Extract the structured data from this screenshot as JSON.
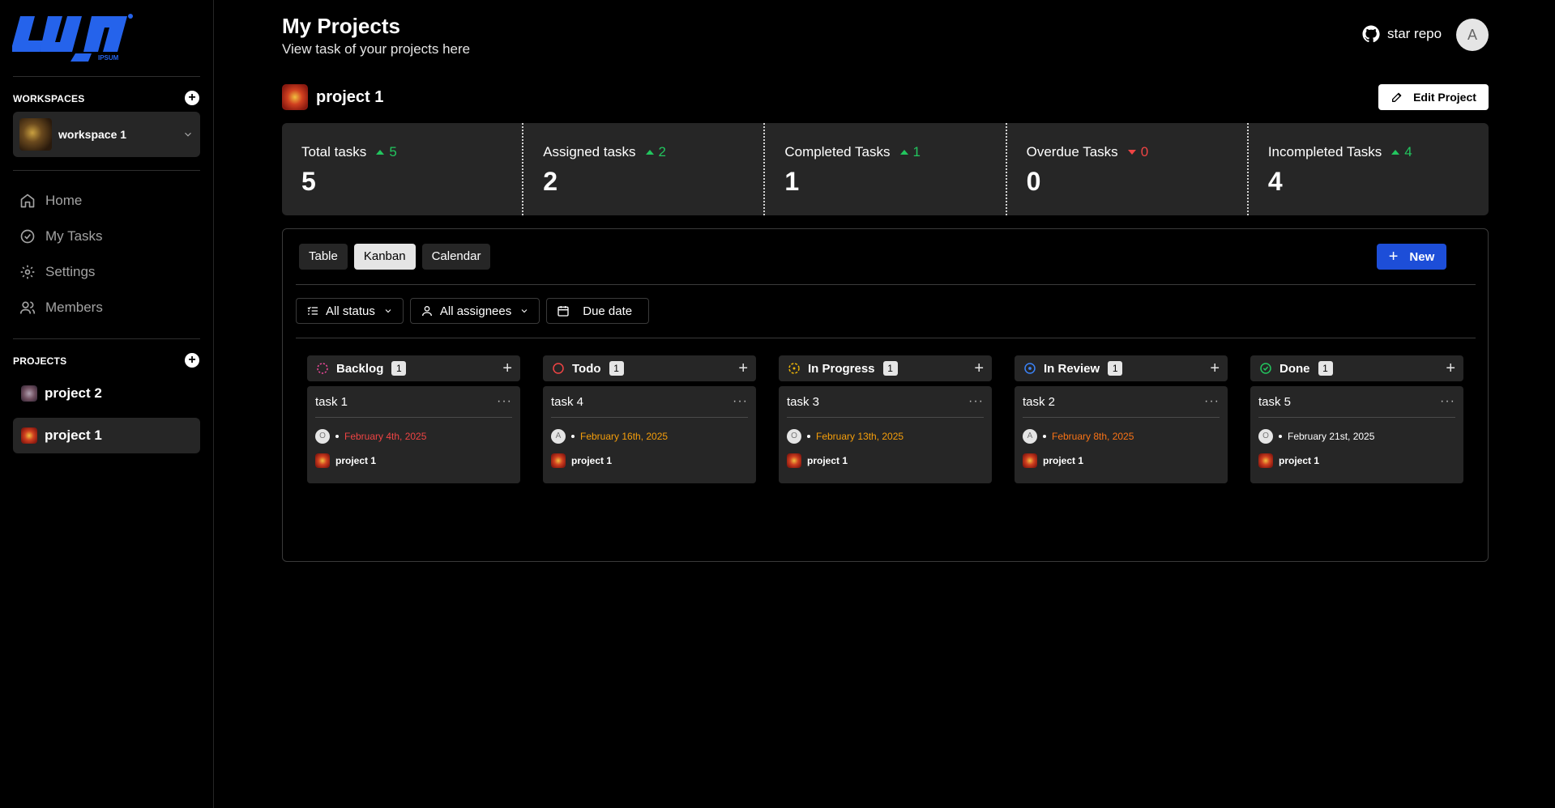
{
  "logo": {
    "subtext": "IPSUM"
  },
  "sidebar": {
    "workspaces_heading": "WORKSPACES",
    "workspace_name": "workspace 1",
    "nav": [
      {
        "label": "Home",
        "icon": "home-icon"
      },
      {
        "label": "My Tasks",
        "icon": "check-circle-icon"
      },
      {
        "label": "Settings",
        "icon": "gear-icon"
      },
      {
        "label": "Members",
        "icon": "users-icon"
      }
    ],
    "projects_heading": "PROJECTS",
    "projects": [
      {
        "name": "project 2",
        "active": false
      },
      {
        "name": "project 1",
        "active": true
      }
    ]
  },
  "header": {
    "title": "My Projects",
    "subtitle": "View task of your projects here",
    "star_repo": "star repo",
    "user_initial": "A"
  },
  "project": {
    "name": "project 1",
    "edit_label": "Edit Project"
  },
  "stats": [
    {
      "label": "Total tasks",
      "delta": "5",
      "trend": "up",
      "value": "5"
    },
    {
      "label": "Assigned tasks",
      "delta": "2",
      "trend": "up",
      "value": "2"
    },
    {
      "label": "Completed Tasks",
      "delta": "1",
      "trend": "up",
      "value": "1"
    },
    {
      "label": "Overdue Tasks",
      "delta": "0",
      "trend": "down",
      "value": "0"
    },
    {
      "label": "Incompleted Tasks",
      "delta": "4",
      "trend": "up",
      "value": "4"
    }
  ],
  "views": {
    "table": "Table",
    "kanban": "Kanban",
    "calendar": "Calendar",
    "active": "Kanban"
  },
  "new_label": "New",
  "filters": {
    "status": "All status",
    "assignees": "All assignees",
    "due": "Due date"
  },
  "columns": [
    {
      "title": "Backlog",
      "count": "1",
      "status_color": "#ec4899",
      "task": {
        "name": "task 1",
        "assignee": "O",
        "due": "February 4th, 2025",
        "due_color": "#ef4444",
        "project": "project 1"
      }
    },
    {
      "title": "Todo",
      "count": "1",
      "status_color": "#ef4444",
      "task": {
        "name": "task 4",
        "assignee": "A",
        "due": "February 16th, 2025",
        "due_color": "#f59e0b",
        "project": "project 1"
      }
    },
    {
      "title": "In Progress",
      "count": "1",
      "status_color": "#eab308",
      "task": {
        "name": "task 3",
        "assignee": "O",
        "due": "February 13th, 2025",
        "due_color": "#f59e0b",
        "project": "project 1"
      }
    },
    {
      "title": "In Review",
      "count": "1",
      "status_color": "#3b82f6",
      "task": {
        "name": "task 2",
        "assignee": "A",
        "due": "February 8th, 2025",
        "due_color": "#f97316",
        "project": "project 1"
      }
    },
    {
      "title": "Done",
      "count": "1",
      "status_color": "#22c55e",
      "task": {
        "name": "task 5",
        "assignee": "O",
        "due": "February 21st, 2025",
        "due_color": "#ffffff",
        "project": "project 1"
      }
    }
  ],
  "colors": {
    "accent": "#1d4ed8",
    "up": "#22c55e",
    "down": "#ef4444"
  }
}
